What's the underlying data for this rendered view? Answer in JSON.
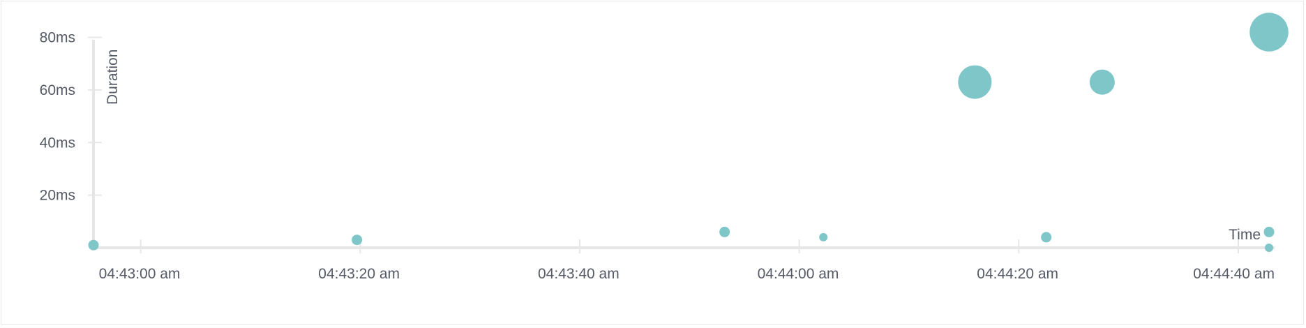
{
  "chart_data": {
    "type": "scatter",
    "xlabel": "Time",
    "ylabel": "Duration",
    "x_ticks": [
      "04:43:00 am",
      "04:43:20 am",
      "04:43:40 am",
      "04:44:00 am",
      "04:44:20 am",
      "04:44:40 am"
    ],
    "y_ticks": [
      "20ms",
      "40ms",
      "60ms",
      "80ms"
    ],
    "y_tick_values": [
      20,
      40,
      60,
      80
    ],
    "xlim": [
      "04:42:55.7",
      "04:44:42.8"
    ],
    "ylim": [
      0,
      82
    ],
    "points": [
      {
        "x": "04:42:55.7",
        "y": 1,
        "size": 1
      },
      {
        "x": "04:43:19.7",
        "y": 3,
        "size": 1
      },
      {
        "x": "04:43:53.2",
        "y": 6,
        "size": 1
      },
      {
        "x": "04:44:02.2",
        "y": 4,
        "size": 0.8
      },
      {
        "x": "04:44:16.0",
        "y": 63,
        "size": 3.2
      },
      {
        "x": "04:44:22.5",
        "y": 4,
        "size": 1
      },
      {
        "x": "04:44:27.6",
        "y": 63,
        "size": 2.4
      },
      {
        "x": "04:44:42.8",
        "y": 82,
        "size": 3.7
      },
      {
        "x": "04:44:42.8",
        "y": 6,
        "size": 1
      },
      {
        "x": "04:44:42.8",
        "y": 0,
        "size": 0.8
      }
    ],
    "grid": false,
    "colors": {
      "point": "#7fc6c9",
      "axis": "#e6e6e6",
      "text": "#555a66"
    }
  }
}
